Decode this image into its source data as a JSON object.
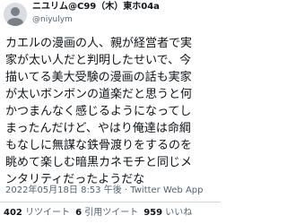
{
  "author": {
    "display_name": "ニユリム@C99（木）東ホ04a",
    "handle": "@niyulym"
  },
  "tweet": {
    "lines": [
      "カエルの漫画の人、親が経営者で実",
      "家が太い人だと判明したせいで、今",
      "描いてる美大受験の漫画の話も実家",
      "が太いボンボンの道楽だと思うと何",
      "かつまんなく感じるようになってし",
      "まったんだけど、やはり俺達は命綱",
      "もなしに無謀な鉄骨渡りをするのを",
      "眺めて楽しむ暗黒カネモチと同じメ",
      "ンタリティだったようだな"
    ],
    "timestamp": "2022年05月18日 8:53 午後",
    "separator": "·",
    "source": "Twitter Web App"
  },
  "stats": {
    "retweets_count": "402",
    "retweets_label": "リツイート",
    "quotes_count": "6",
    "quotes_label": "引用ツイート",
    "likes_count": "959",
    "likes_label": "いいね"
  },
  "colors": {
    "text": "#0f1419",
    "secondary": "#536471",
    "divider": "#cfd9de"
  }
}
